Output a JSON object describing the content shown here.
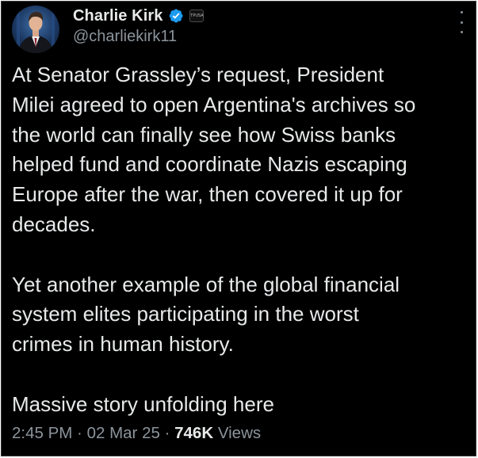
{
  "author": {
    "display_name": "Charlie Kirk",
    "handle": "@charliekirk11",
    "verified": true,
    "verified_icon": "verified-badge-icon",
    "affiliation_badge_icon": "affiliation-badge-icon",
    "affiliation_badge_text": "TPUSA"
  },
  "menu_icon": "more-options-icon",
  "tweet": {
    "paragraphs": [
      "At Senator Grassley’s request, President\nMilei agreed to open Argentina's archives so\nthe world can finally see how Swiss banks\nhelped fund and coordinate Nazis escaping\nEurope after the war, then covered it up for\ndecades.",
      "Yet another example of the global financial\nsystem elites participating in the worst\ncrimes in human history.",
      "Massive story unfolding here"
    ]
  },
  "meta": {
    "time": "2:45 PM",
    "separator": " · ",
    "date": "02 Mar 25",
    "views_count": "746K",
    "views_label": " Views"
  },
  "colors": {
    "background": "#000000",
    "text": "#e7e9ea",
    "secondary_text": "#8b949b",
    "verified_blue": "#1d9bf0"
  }
}
